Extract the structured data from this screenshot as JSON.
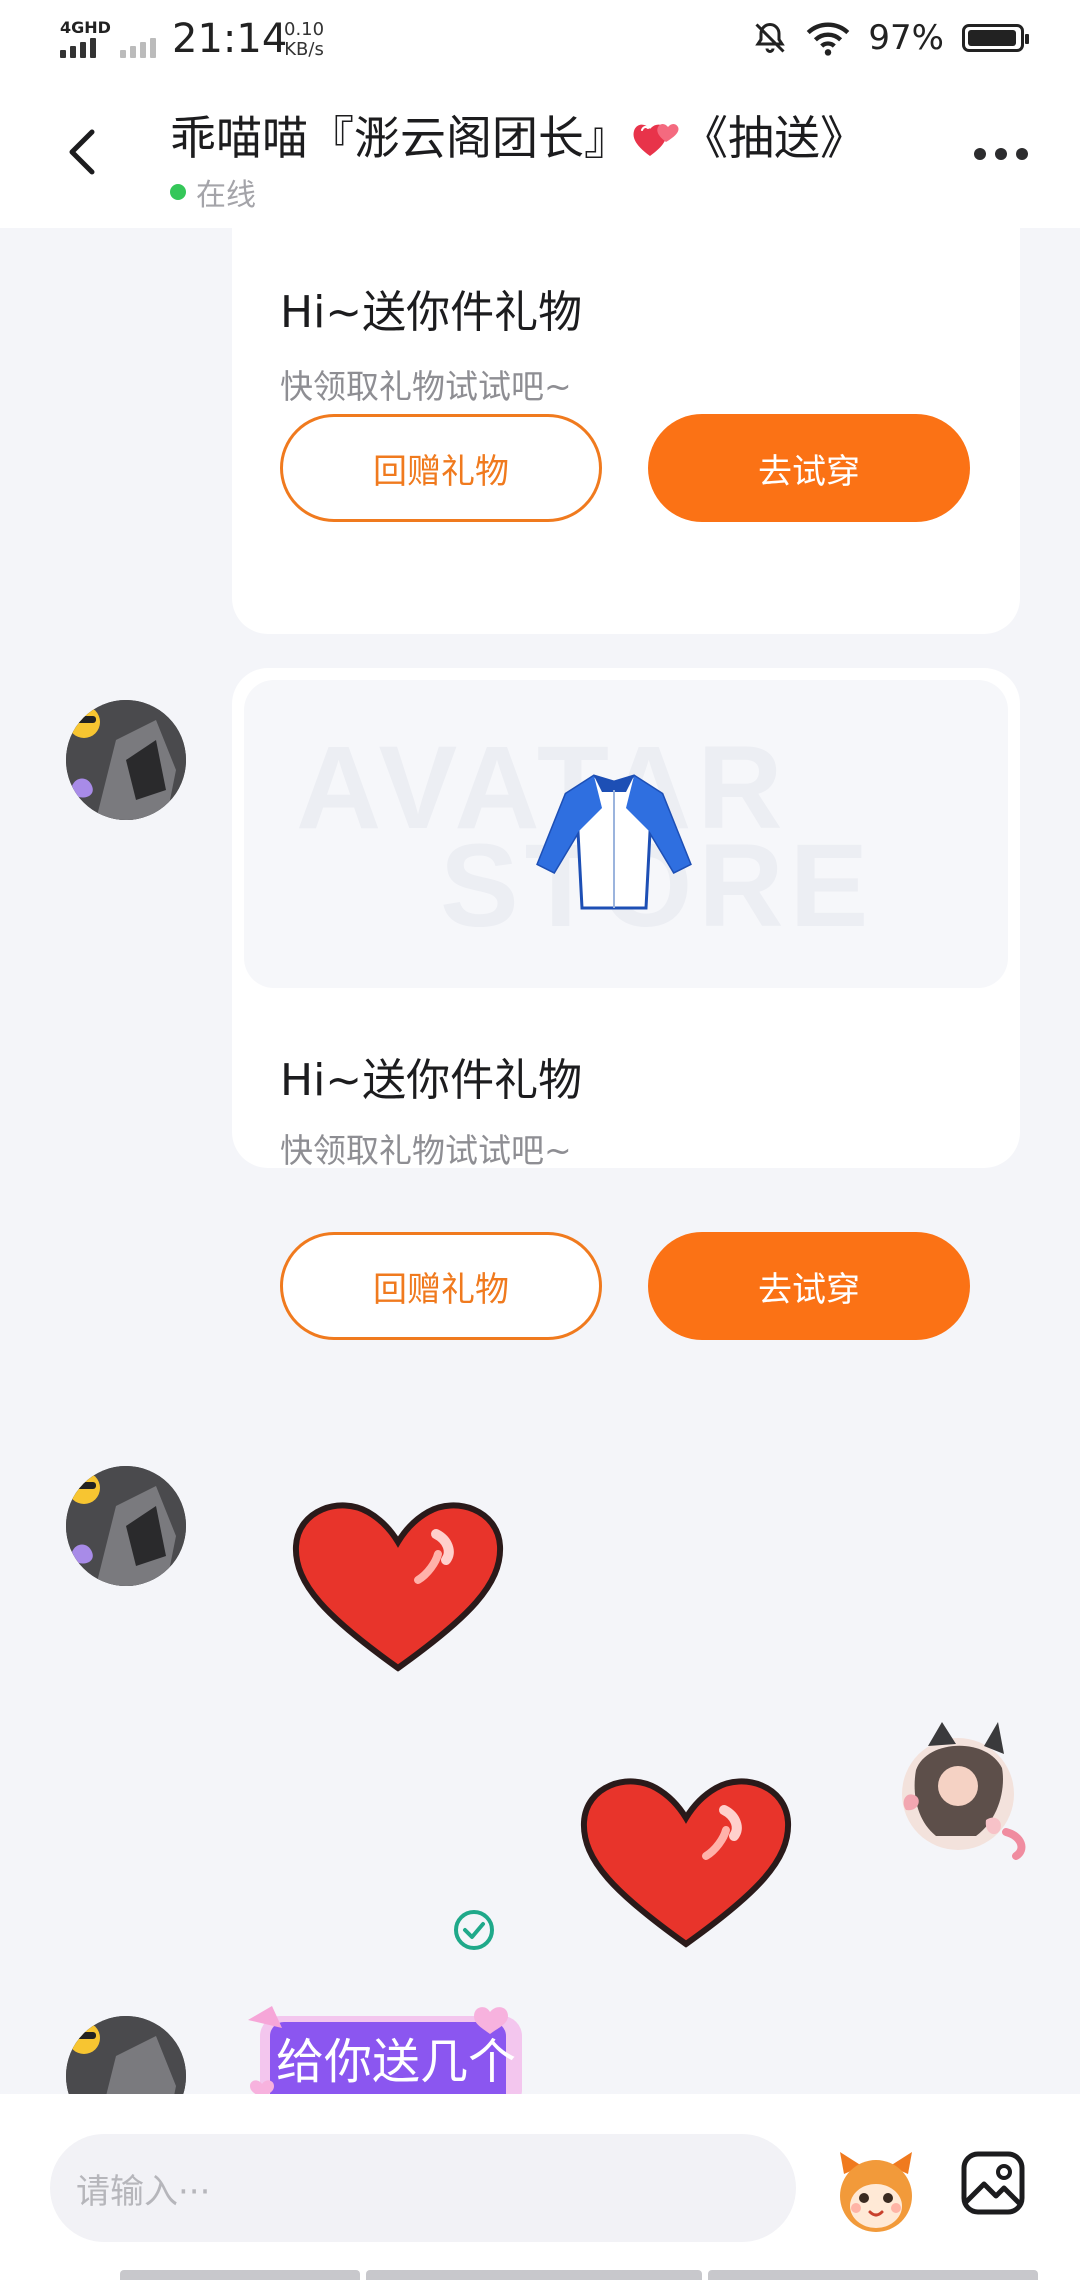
{
  "status_bar": {
    "network": "4GHD",
    "time": "21:14",
    "speed_value": "0.10",
    "speed_unit": "KB/s",
    "battery": "97%"
  },
  "header": {
    "title_prefix": "乖喵喵『浵云阁团长』",
    "title_suffix": "《抽送》",
    "status": "在线"
  },
  "messages": {
    "gift_card_1": {
      "title": "Hi~送你件礼物",
      "subtitle": "快领取礼物试试吧~",
      "return_gift_label": "回赠礼物",
      "try_on_label": "去试穿"
    },
    "gift_card_2": {
      "title": "Hi~送你件礼物",
      "subtitle": "快领取礼物试试吧~",
      "return_gift_label": "回赠礼物",
      "try_on_label": "去试穿",
      "image_watermark_1": "AVATAR",
      "image_watermark_2": "STORE"
    },
    "banner_text": "给你送几个"
  },
  "input": {
    "placeholder": "请输入···"
  },
  "colors": {
    "accent": "#fb7215",
    "online": "#34c759",
    "check": "#1fa98a"
  }
}
